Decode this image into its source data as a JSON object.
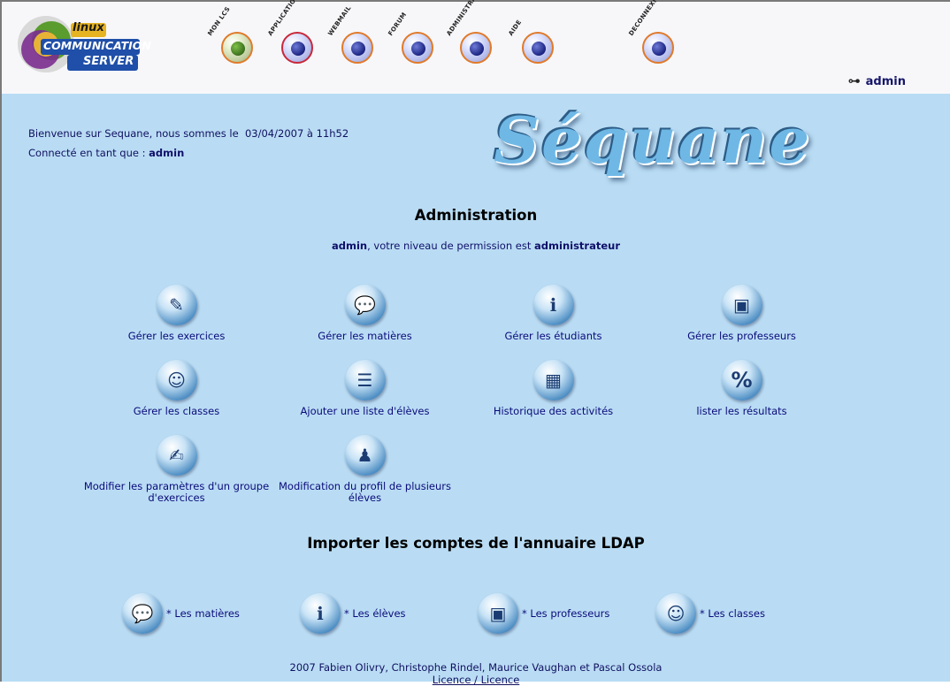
{
  "header": {
    "logo_text": [
      "linux",
      "COMMUNICATION",
      "SERVER"
    ],
    "nav": [
      {
        "label": "MON LCS",
        "icon": "lcs-ball-icon"
      },
      {
        "label": "APPLICATIONS",
        "icon": "applications-icon"
      },
      {
        "label": "WEBMAIL",
        "icon": "webmail-icon"
      },
      {
        "label": "FORUM",
        "icon": "forum-icon"
      },
      {
        "label": "ADMINISTRATION",
        "icon": "administration-icon"
      },
      {
        "label": "AIDE",
        "icon": "help-icon"
      },
      {
        "label": "DECONNEXION",
        "icon": "logout-icon"
      }
    ],
    "user": "admin"
  },
  "main": {
    "welcome_prefix": "Bienvenue sur Sequane, nous sommes le",
    "datetime": "03/04/2007 à 11h52",
    "connected_prefix": "Connecté en tant que :",
    "connected_user": "admin",
    "logo_title": "Séquane",
    "admin_title": "Administration",
    "perm_user": "admin",
    "perm_text": ", votre niveau de permission est ",
    "perm_level": "administrateur",
    "tiles": [
      {
        "label": "Gérer les exercices",
        "icon": "pencil-icon",
        "glyph": "✎"
      },
      {
        "label": "Gérer les matières",
        "icon": "speech-bubble-icon",
        "glyph": "💬"
      },
      {
        "label": "Gérer les étudiants",
        "icon": "student-icon",
        "glyph": "ℹ"
      },
      {
        "label": "Gérer les professeurs",
        "icon": "teacher-desk-icon",
        "glyph": "▣"
      },
      {
        "label": "Gérer les classes",
        "icon": "group-icon",
        "glyph": "☺"
      },
      {
        "label": "Ajouter une liste d'élèves",
        "icon": "list-icon",
        "glyph": "☰"
      },
      {
        "label": "Historique des activités",
        "icon": "calendar-clock-icon",
        "glyph": "▦"
      },
      {
        "label": "lister les résultats",
        "icon": "percent-icon",
        "glyph": "%"
      },
      {
        "label": "Modifier les paramètres d'un groupe d'exercices",
        "icon": "edit-document-icon",
        "glyph": "✍"
      },
      {
        "label": "Modification du profil de plusieurs élèves",
        "icon": "multiple-users-icon",
        "glyph": "♟"
      }
    ],
    "ldap_title": "Importer les comptes de l'annuaire LDAP",
    "imports": [
      {
        "label": "* Les matières",
        "icon": "speech-bubble-icon",
        "glyph": "💬"
      },
      {
        "label": "* Les élèves",
        "icon": "student-icon",
        "glyph": "ℹ"
      },
      {
        "label": "* Les professeurs",
        "icon": "teacher-desk-icon",
        "glyph": "▣"
      },
      {
        "label": "* Les classes",
        "icon": "group-icon",
        "glyph": "☺"
      }
    ],
    "footer_credits": "2007 Fabien Olivry, Christophe Rindel, Maurice Vaughan et Pascal Ossola",
    "footer_links": "Licence / Licence"
  }
}
